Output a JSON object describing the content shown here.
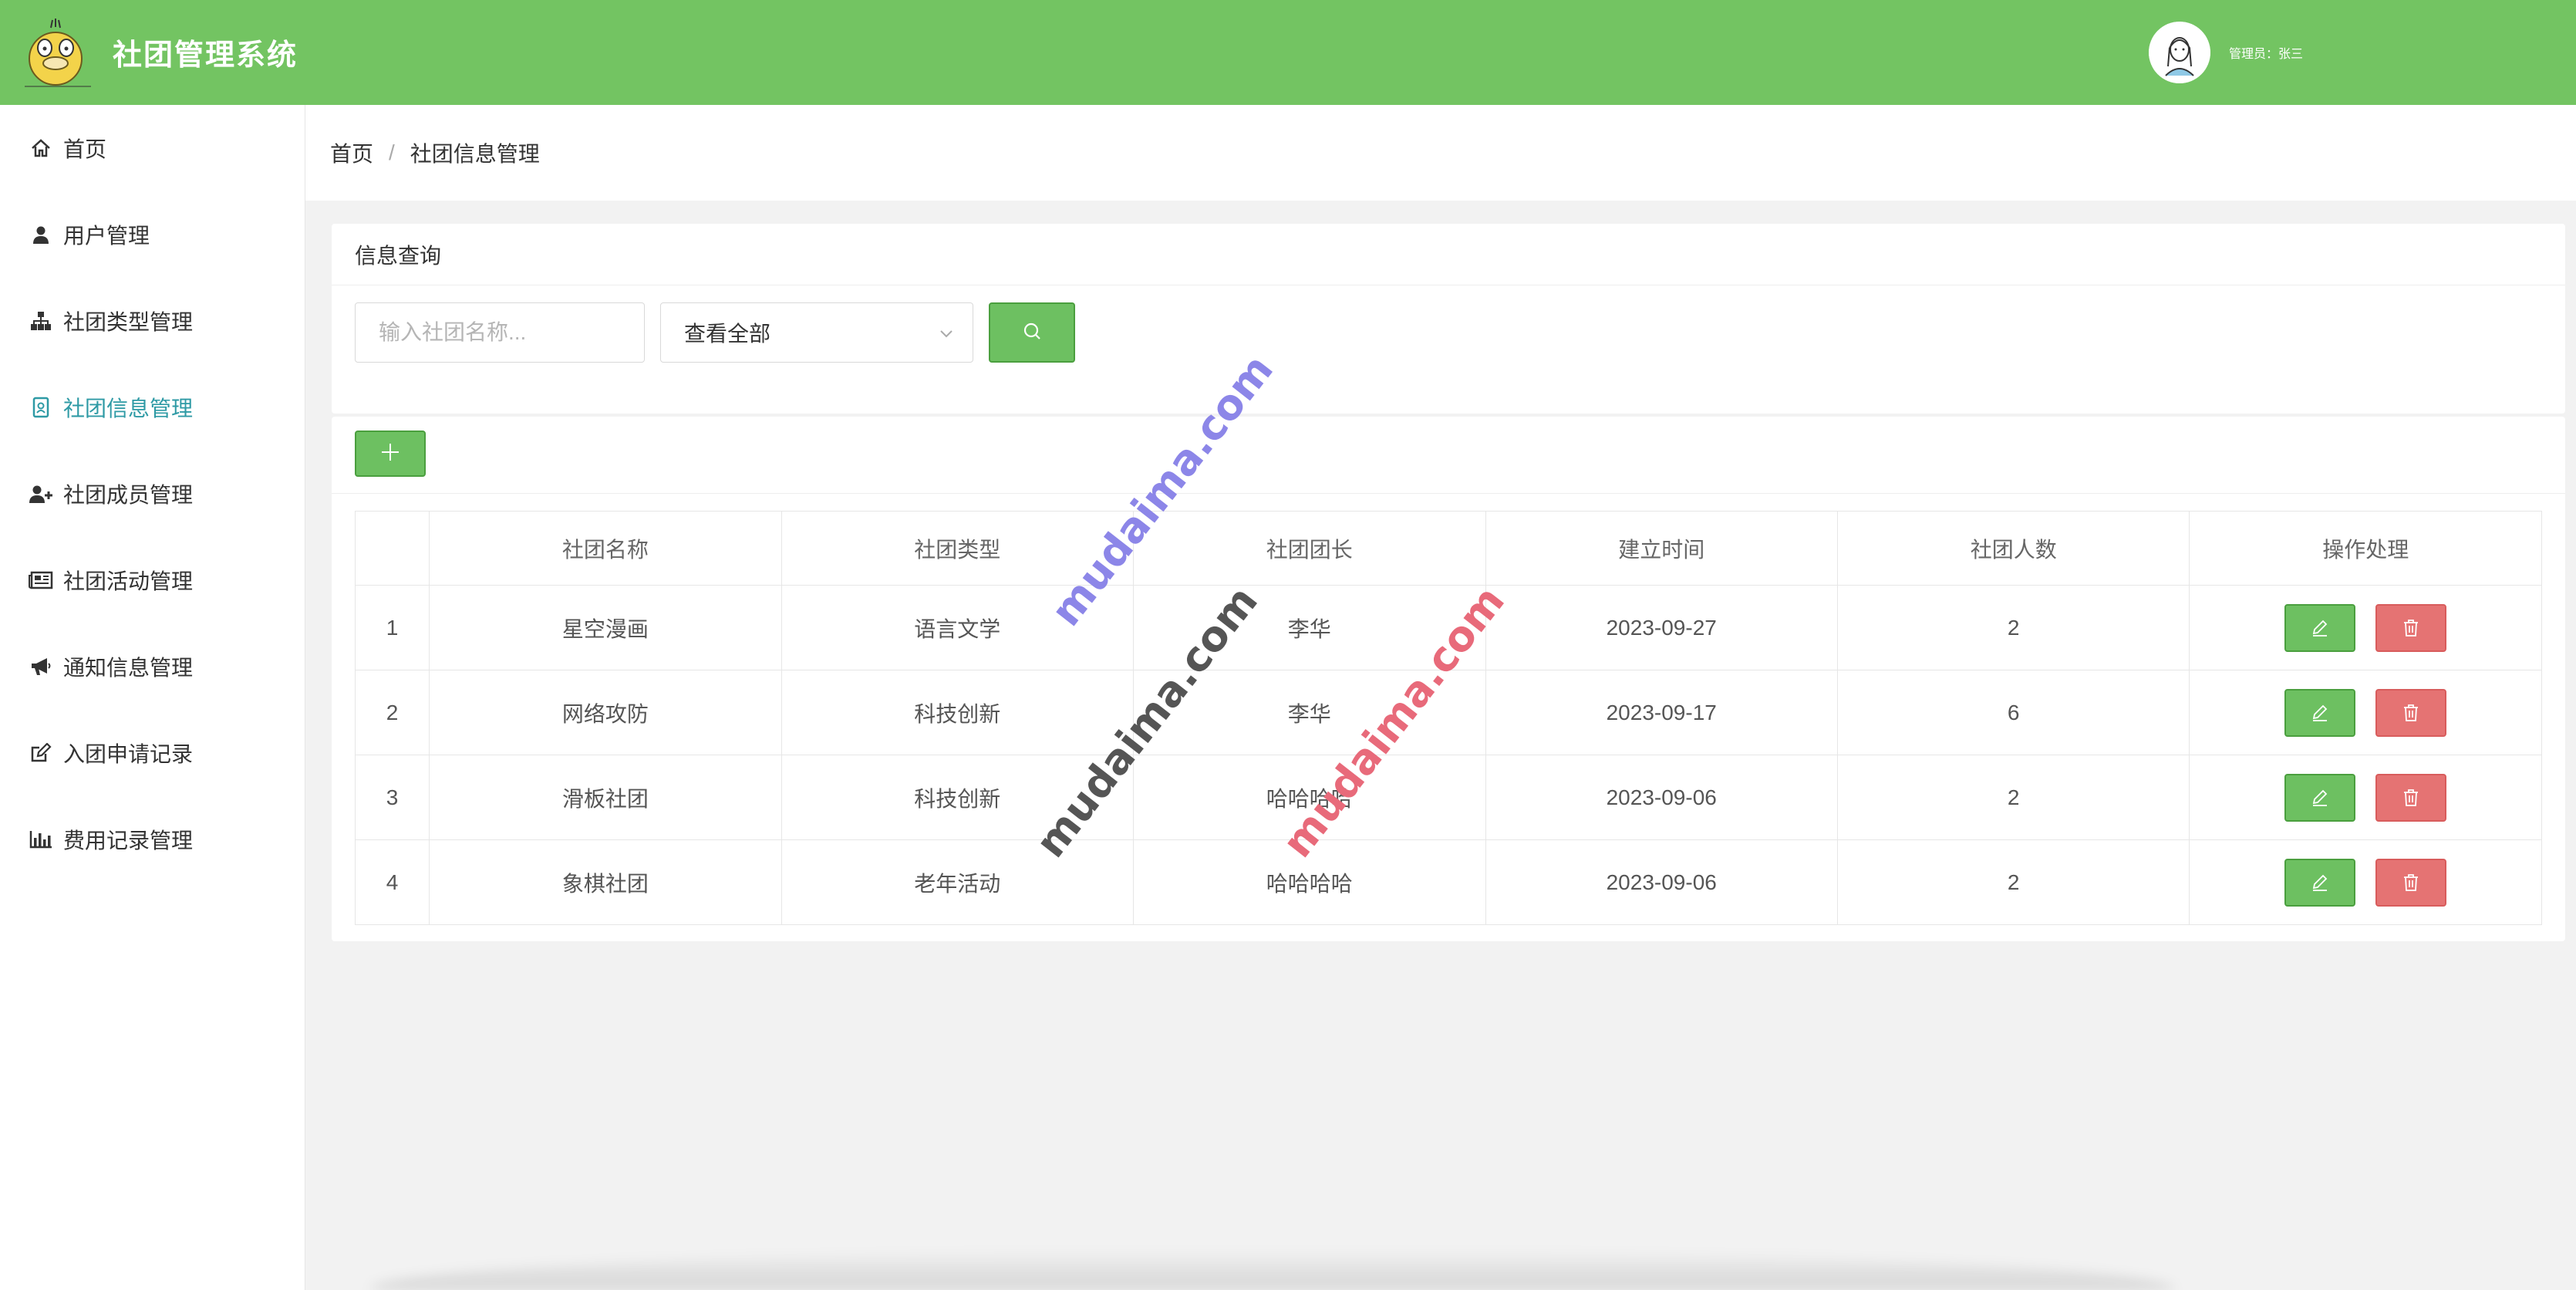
{
  "header": {
    "title": "社团管理系统",
    "admin_label": "管理员：张三",
    "brand_color": "#73c462"
  },
  "sidebar": {
    "items": [
      {
        "label": "首页",
        "icon": "home-icon"
      },
      {
        "label": "用户管理",
        "icon": "user-icon"
      },
      {
        "label": "社团类型管理",
        "icon": "sitemap-icon"
      },
      {
        "label": "社团信息管理",
        "icon": "id-badge-icon",
        "active": true
      },
      {
        "label": "社团成员管理",
        "icon": "user-plus-icon"
      },
      {
        "label": "社团活动管理",
        "icon": "newspaper-icon"
      },
      {
        "label": "通知信息管理",
        "icon": "bullhorn-icon"
      },
      {
        "label": "入团申请记录",
        "icon": "edit-icon"
      },
      {
        "label": "费用记录管理",
        "icon": "bar-chart-icon"
      }
    ],
    "active_color": "#2e9aa5"
  },
  "breadcrumb": {
    "home": "首页",
    "separator": "/",
    "current": "社团信息管理"
  },
  "query": {
    "title": "信息查询",
    "name_placeholder": "输入社团名称...",
    "type_select_value": "查看全部"
  },
  "table": {
    "headers": [
      "",
      "社团名称",
      "社团类型",
      "社团团长",
      "建立时间",
      "社团人数",
      "操作处理"
    ],
    "rows": [
      {
        "index": "1",
        "name": "星空漫画",
        "type": "语言文学",
        "leader": "李华",
        "date": "2023-09-27",
        "count": "2"
      },
      {
        "index": "2",
        "name": "网络攻防",
        "type": "科技创新",
        "leader": "李华",
        "date": "2023-09-17",
        "count": "6"
      },
      {
        "index": "3",
        "name": "滑板社团",
        "type": "科技创新",
        "leader": "哈哈哈哈",
        "date": "2023-09-06",
        "count": "2"
      },
      {
        "index": "4",
        "name": "象棋社团",
        "type": "老年活动",
        "leader": "哈哈哈哈",
        "date": "2023-09-06",
        "count": "2"
      }
    ]
  },
  "watermarks": [
    "mudaima.com",
    "mudaima.com",
    "mudaima.com"
  ],
  "colors": {
    "edit_button": "#6dc061",
    "delete_button": "#e57373"
  }
}
